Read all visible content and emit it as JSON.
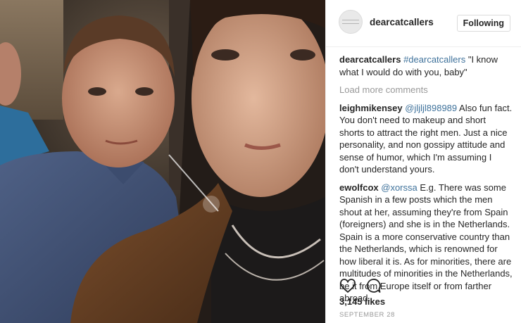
{
  "header": {
    "username": "dearcatcallers",
    "follow_label": "Following",
    "avatar_icon": "profile-avatar-icon"
  },
  "caption": {
    "author": "dearcatcallers",
    "hashtag": "#dearcatcallers",
    "text": " \"I know what I would do with you, baby\""
  },
  "load_more": "Load more comments",
  "comments": [
    {
      "author": "leighmikensey",
      "mention": "@jljljl898989",
      "text": " Also fun fact. You don't need to makeup and short shorts to attract the right men. Just a nice personality, and non gossipy attitude and sense of humor, which I'm assuming I don't understand yours."
    },
    {
      "author": "ewolfcox",
      "mention": "@xorssa",
      "text": " E.g. There was some Spanish in a few posts which the men shout at her, assuming they're from Spain (foreigners) and she is in the Netherlands. Spain is a more conservative country than the Netherlands, which is renowned for how liberal it is. As for minorities, there are multitudes of minorities in the Netherlands, be it from Europe itself or from farther abroad."
    }
  ],
  "actions": {
    "like_icon": "heart-icon",
    "comment_icon": "comment-bubble-icon"
  },
  "likes": "3,145 likes",
  "date": "SEPTEMBER 28",
  "colors": {
    "link": "#3f729b",
    "muted": "#999999",
    "text": "#262626",
    "border": "#dbdbdb"
  }
}
